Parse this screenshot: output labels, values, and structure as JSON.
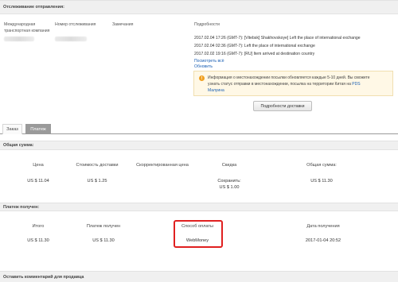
{
  "tracking": {
    "title": "Отслеживание отправления:",
    "columns": {
      "carrier_line1": "Международная",
      "carrier_line2": "транспортная компания",
      "tracking_number": "Номер отслеживания",
      "note": "Замечания",
      "details": "Подробности"
    },
    "events": [
      "2017.02.04 17:26 (GMT-7): [Vitebsk] Shakhovskoye] Left the place of international exchange",
      "2017.02.04 02:36 (GMT-7): Left the place of international exchange",
      "2017.02.02 19:16 (GMT-7): [RU] Item arrived at destination country"
    ],
    "view_all_link": "Посмотреть всё",
    "refresh_link": "Обновить",
    "info_text_1": "Информация о местонахождении посылки обновляется каждые 5-10 дней. Вы сможете",
    "info_text_2": "узнать статус отправки в местонахождении, посылка на территории Китая на",
    "info_link_1": "PDS",
    "info_link_2": "Малуина",
    "delivery_details_button": "Подробности доставки"
  },
  "tabs": [
    {
      "label": "Заказ"
    },
    {
      "label": "Платеж"
    }
  ],
  "total": {
    "title": "Общая сумма:",
    "headers": [
      "Цена",
      "Стоимость доставки",
      "Скорректированная цена",
      "Скидка",
      "Общая сумма:"
    ],
    "values": [
      "US $ 11.04",
      "US $ 1.25",
      "",
      "Сохранить:",
      "US $ 11.30"
    ],
    "discount_amount": "US $ 1.00"
  },
  "payment": {
    "title": "Платеж получен:",
    "headers": [
      "Итого",
      "Платеж получен",
      "Способ оплаты",
      "Дата получения"
    ],
    "values": [
      "US $ 11.30",
      "US $ 11.30",
      "WebMoney",
      "2017-01-04 20:52"
    ]
  },
  "comment_section": {
    "title": "Оставить комментарий для продавца"
  },
  "colors": {
    "highlight_box": "#e02020",
    "link": "#1a5fb4",
    "info_icon": "#f0a020",
    "active_tab": "#9a9a9a"
  }
}
